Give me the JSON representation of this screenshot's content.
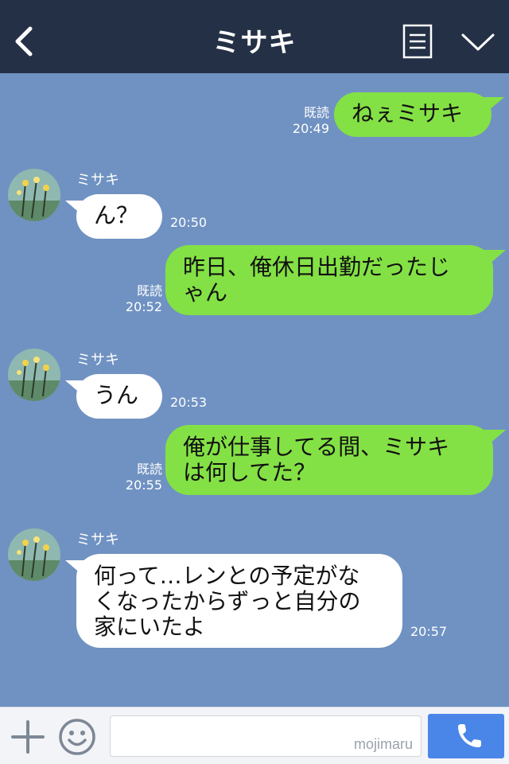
{
  "header": {
    "title": "ミサキ",
    "back_icon": "chevron-left-icon",
    "menu_icon": "list-icon",
    "collapse_icon": "chevron-down-icon",
    "background": "#243046"
  },
  "chat": {
    "background": "#7092c2",
    "messages": [
      {
        "from": "me",
        "text": "ねぇミサキ",
        "read": "既読",
        "time": "20:49"
      },
      {
        "from": "ミサキ",
        "sender": "ミサキ",
        "text": "ん？",
        "time": "20:50"
      },
      {
        "from": "me",
        "lines": [
          "昨日、俺休日出勤だったじ",
          "ゃん"
        ],
        "read": "既読",
        "time": "20:52"
      },
      {
        "from": "ミサキ",
        "sender": "ミサキ",
        "text": "うん",
        "time": "20:53"
      },
      {
        "from": "me",
        "lines": [
          "俺が仕事してる間、ミサキ",
          "は何してた？"
        ],
        "read": "既読",
        "time": "20:55"
      },
      {
        "from": "ミサキ",
        "sender": "ミサキ",
        "lines": [
          "何って…レンとの予定がな",
          "くなったからずっと自分の",
          "家にいたよ"
        ],
        "time": "20:57"
      }
    ]
  },
  "input_bar": {
    "value": "",
    "watermark": "mojimaru",
    "plus_icon": "plus-icon",
    "emoji_icon": "smile-icon",
    "call_icon": "phone-icon",
    "call_color": "#4a85e8"
  },
  "colors": {
    "outgoing_bubble": "#84e145",
    "incoming_bubble": "#ffffff"
  }
}
